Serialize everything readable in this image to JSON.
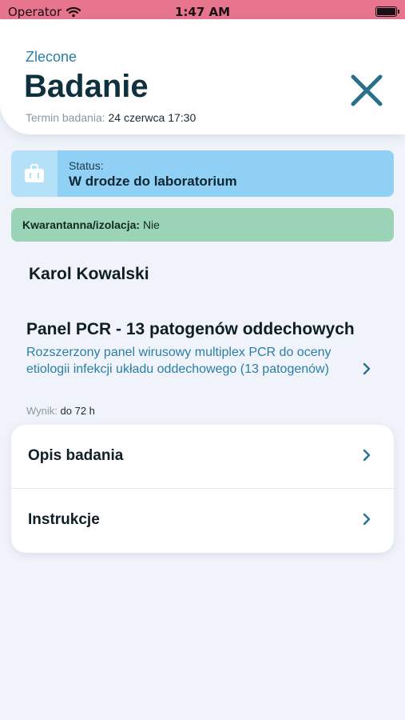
{
  "status_bar": {
    "carrier": "Operator",
    "time": "1:47 AM"
  },
  "header": {
    "kicker": "Zlecone",
    "title": "Badanie",
    "date_label": "Termin badania:",
    "date_value": "24 czerwca 17:30"
  },
  "status": {
    "label": "Status:",
    "value": "W drodze do laboratorium"
  },
  "quarantine": {
    "label": "Kwarantanna/izolacja:",
    "value": "Nie"
  },
  "patient": {
    "name": "Karol Kowalski"
  },
  "test": {
    "title": "Panel PCR - 13 patogenów oddechowych",
    "description": "Rozszerzony panel wirusowy multiplex PCR do oceny etiologii infekcji układu oddechowego (13 patogenów)",
    "result_label": "Wynik:",
    "result_value": "do 72 h"
  },
  "menu": {
    "items": [
      {
        "label": "Opis badania"
      },
      {
        "label": "Instrukcje"
      }
    ]
  },
  "colors": {
    "status_bar": "#e7758e",
    "accent": "#2a7fa5",
    "status_card": "#8fd0f4",
    "quarantine_card": "#9bd3b6",
    "background": "#f0f3fa"
  },
  "icons": [
    "wifi-icon",
    "battery-icon",
    "close-icon",
    "suitcase-icon",
    "chevron-right-icon"
  ]
}
